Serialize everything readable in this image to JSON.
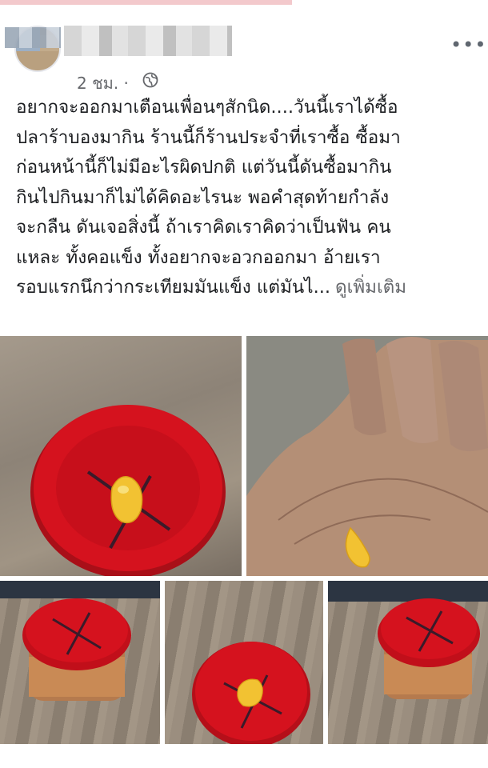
{
  "post": {
    "time": "2 ชม. ·",
    "more_label": "•••",
    "text_lines": [
      "อยากจะออกมาเตือนเพื่อนๆสักนิด....วันนี้เราได้ซื้อ",
      "ปลาร้าบองมากิน ร้านนี้ก็ร้านประจำที่เราซื้อ ซื้อมา",
      "ก่อนหน้านี้ก็ไม่มีอะไรผิดปกติ แต่วันนี้ดันซื้อมากิน",
      "กินไปกินมาก็ไม่ได้คิดอะไรนะ พอคำสุดท้ายกำลัง",
      "จะกลืน ดันเจอสิ่งนี้ ถ้าเราคิดเราคิดว่าเป็นฟัน คน",
      "แหละ ทั้งคอแข็ง ทั้งอยากจะอวกออกมา อ้ายเรา",
      "รอบแรกนึกว่ากระเทียมมันแข็ง แต่มันไ..."
    ],
    "see_more": "ดูเพิ่มเติม"
  },
  "colors": {
    "lid_red": "#d5121e",
    "tooth": "#f2c232",
    "secondary_text": "#65676b"
  },
  "photos": [
    {
      "name": "tooth-on-red-lid-photo"
    },
    {
      "name": "tooth-on-palm-photo"
    },
    {
      "name": "red-jar-photo-1"
    },
    {
      "name": "tooth-on-lid-photo-2"
    },
    {
      "name": "red-jar-photo-2"
    }
  ]
}
